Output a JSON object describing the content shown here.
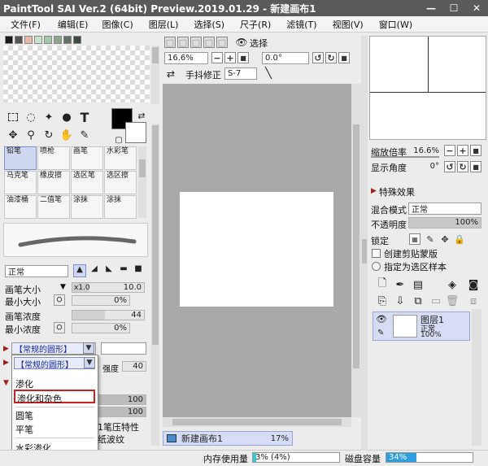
{
  "window": {
    "title": "PaintTool SAI Ver.2 (64bit) Preview.2019.01.29 - 新建画布1",
    "minimize": "—",
    "maximize": "☐",
    "close": "✕"
  },
  "menu": [
    "文件(F)",
    "编辑(E)",
    "图像(C)",
    "图层(L)",
    "选择(S)",
    "尺子(R)",
    "滤镜(T)",
    "视图(V)",
    "窗口(W)"
  ],
  "colors": {
    "swatches": [
      "#1a1a1a",
      "#555555",
      "#e7b7a7",
      "#c9e3d0",
      "#a2c7a9",
      "#8da58f",
      "#65706a",
      "#3c4a40"
    ],
    "primary": "#000000",
    "secondary": "#ffffff"
  },
  "brushes": [
    [
      "铅笔",
      "喷枪",
      "画笔",
      "水彩笔"
    ],
    [
      "马克笔",
      "橡皮擦",
      "选区笔",
      "选区擦"
    ],
    [
      "油漆桶",
      "二值笔",
      "涂抹",
      "涂抹"
    ]
  ],
  "brush_settings": {
    "blend_mode": "正常",
    "size_label": "画笔大小",
    "size_mult": "x1.0",
    "size_val": "10.0",
    "min_size_label": "最小大小",
    "min_size_val": "0%",
    "density_label": "画笔浓度",
    "density_val": "44",
    "min_density_label": "最小浓度",
    "min_density_val": "0%",
    "shape_value": "【常规的圆形】",
    "strength_label": "强度",
    "strength_val": "40",
    "val_100a": "100",
    "val_100b": "100",
    "pressure_fragment": "1笔压特性",
    "texture_fragment": "纸波纹"
  },
  "shape_dropdown": {
    "header": "【常规的圆形】",
    "options": [
      "渗化",
      "渗化和杂色",
      "圆笔",
      "平笔",
      "水彩渗化"
    ],
    "highlighted": "渗化和杂色"
  },
  "toolbar": {
    "select_label": "选择",
    "zoom": "16.6%",
    "angle": "0.0°",
    "stabilizer_label": "手抖修正",
    "stabilizer_val": "S-7"
  },
  "canvas_tab": {
    "name": "新建画布1",
    "percent": "17%"
  },
  "status": {
    "memory_label": "内存使用量",
    "memory_val": "3% (4%)",
    "memory_fraction": 0.03,
    "disk_label": "磁盘容量",
    "disk_val": "34%",
    "disk_fraction": 0.34
  },
  "navigator": {
    "zoom_label": "缩放倍率",
    "zoom_val": "16.6%",
    "angle_label": "显示角度",
    "angle_val": "0°"
  },
  "layer_panel": {
    "effects_label": "特殊效果",
    "mode_label": "混合模式",
    "mode_val": "正常",
    "opacity_label": "不透明度",
    "opacity_val": "100%",
    "lock_label": "锁定",
    "clip_label": "创建剪贴蒙版",
    "select_src_label": "指定为选区样本",
    "layer": {
      "name": "图层1",
      "mode": "正常",
      "opacity": "100%"
    }
  }
}
